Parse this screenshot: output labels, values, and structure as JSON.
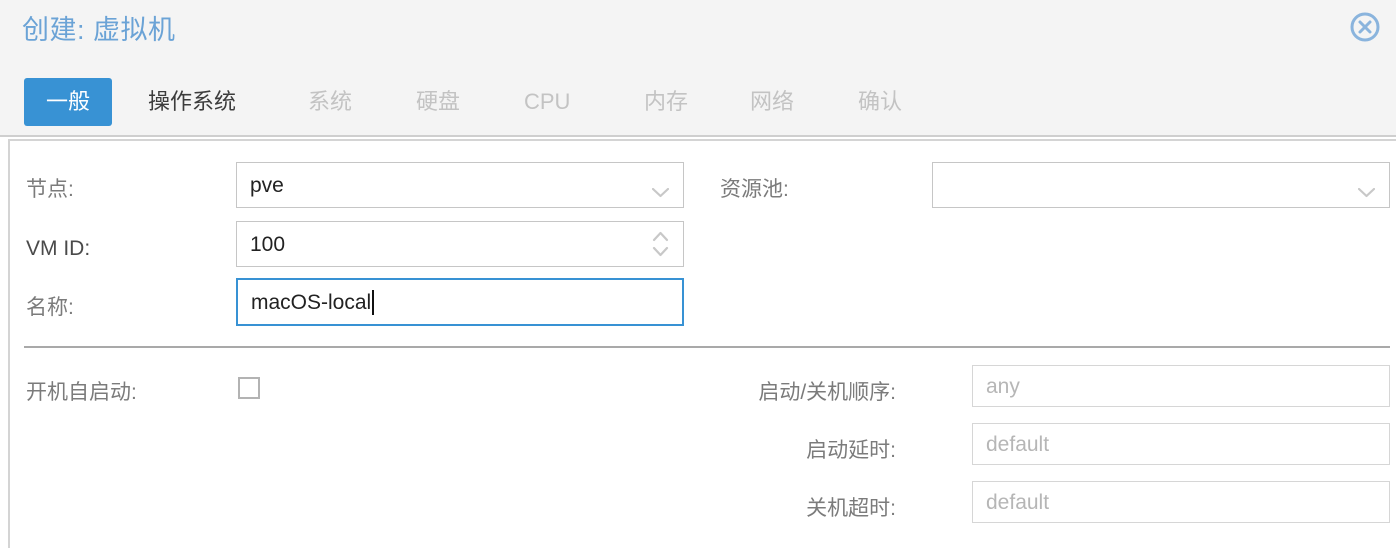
{
  "dialog": {
    "title": "创建: 虚拟机",
    "close_icon": "close-circle-icon",
    "accent_color": "#3892d4",
    "title_color": "#6ba3d6"
  },
  "tabs": [
    {
      "label": "一般",
      "state": "active"
    },
    {
      "label": "操作系统",
      "state": "enabled"
    },
    {
      "label": "系统",
      "state": "disabled"
    },
    {
      "label": "硬盘",
      "state": "disabled"
    },
    {
      "label": "CPU",
      "state": "disabled"
    },
    {
      "label": "内存",
      "state": "disabled"
    },
    {
      "label": "网络",
      "state": "disabled"
    },
    {
      "label": "确认",
      "state": "disabled"
    }
  ],
  "form": {
    "node": {
      "label": "节点:",
      "value": "pve",
      "control": "dropdown",
      "icon": "chevron-down-icon"
    },
    "vmid": {
      "label": "VM ID:",
      "value": "100",
      "control": "spinner",
      "icon": "spinner-updown-icon"
    },
    "name": {
      "label": "名称:",
      "value": "macOS-local",
      "control": "textfield",
      "focused": true
    },
    "pool": {
      "label": "资源池:",
      "value": "",
      "control": "dropdown",
      "icon": "chevron-down-icon"
    },
    "start_at_boot": {
      "label": "开机自启动:",
      "checked": false,
      "control": "checkbox"
    },
    "start_order": {
      "label": "启动/关机顺序:",
      "placeholder": "any",
      "value": "",
      "control": "textfield"
    },
    "startup_delay": {
      "label": "启动延时:",
      "placeholder": "default",
      "value": "",
      "control": "textfield"
    },
    "shutdown_timeout": {
      "label": "关机超时:",
      "placeholder": "default",
      "value": "",
      "control": "textfield"
    }
  }
}
